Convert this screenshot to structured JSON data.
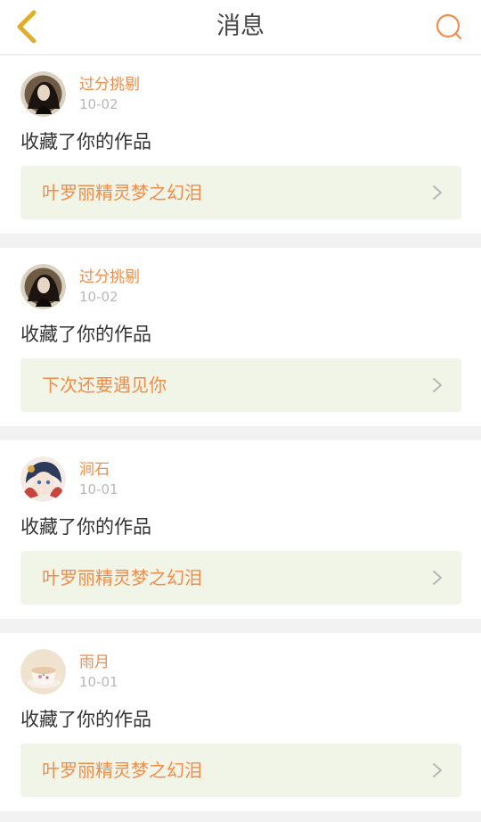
{
  "header": {
    "title": "消息"
  },
  "colors": {
    "accent": "#f28c48",
    "back_icon": "#e0ae2b",
    "link_background": "#f1f5e7"
  },
  "icons": {
    "back": "back-chevron-icon",
    "search": "search-icon",
    "row_arrow": "chevron-right-icon"
  },
  "messages": [
    {
      "username": "过分挑剔",
      "date": "10-02",
      "action": "收藏了你的作品",
      "work_title": "叶罗丽精灵梦之幻泪",
      "avatar": "dark-portrait-avatar"
    },
    {
      "username": "过分挑剔",
      "date": "10-02",
      "action": "收藏了你的作品",
      "work_title": "下次还要遇见你",
      "avatar": "dark-portrait-avatar"
    },
    {
      "username": "涧石",
      "date": "10-01",
      "action": "收藏了你的作品",
      "work_title": "叶罗丽精灵梦之幻泪",
      "avatar": "anime-girl-avatar"
    },
    {
      "username": "雨月",
      "date": "10-01",
      "action": "收藏了你的作品",
      "work_title": "叶罗丽精灵梦之幻泪",
      "avatar": "teacup-avatar"
    }
  ]
}
